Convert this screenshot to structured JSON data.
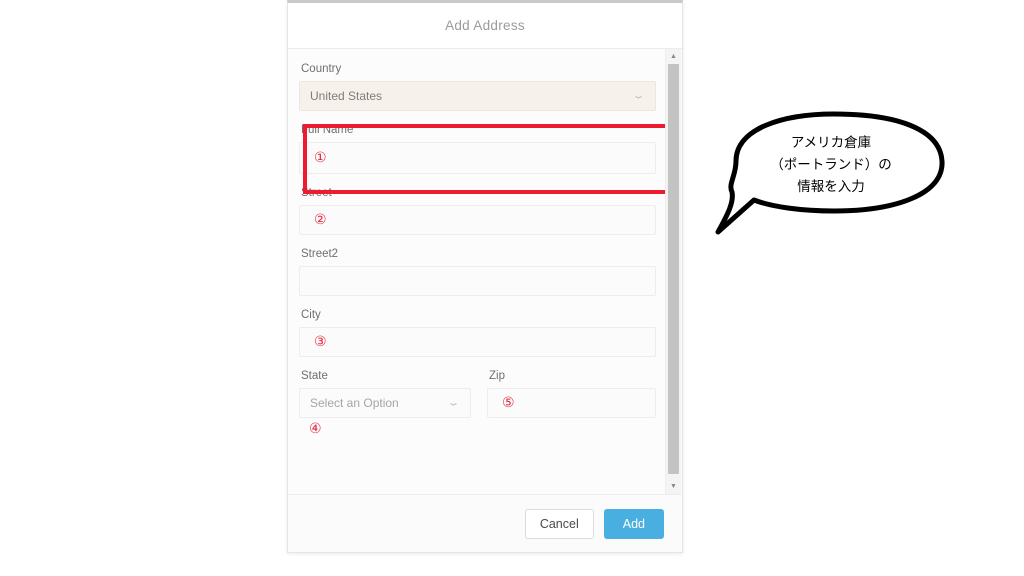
{
  "modal": {
    "title": "Add Address",
    "fields": {
      "country": {
        "label": "Country",
        "value": "United States",
        "chevron": "⌄"
      },
      "full_name": {
        "label": "Full Name",
        "value": "",
        "marker": "①"
      },
      "street": {
        "label": "Street",
        "value": "",
        "marker": "②"
      },
      "street2": {
        "label": "Street2",
        "value": ""
      },
      "city": {
        "label": "City",
        "value": "",
        "marker": "③"
      },
      "state": {
        "label": "State",
        "placeholder": "Select an Option",
        "chevron": "⌄",
        "marker": "④"
      },
      "zip": {
        "label": "Zip",
        "value": "",
        "marker": "⑤"
      }
    },
    "footer": {
      "cancel_label": "Cancel",
      "add_label": "Add"
    },
    "scrollbar": {
      "up_arrow": "▲",
      "down_arrow": "▼"
    }
  },
  "callout": {
    "text": "アメリカ倉庫\n（ポートランド）の\n情報を入力"
  },
  "colors": {
    "highlight_red": "#ed1b2f",
    "marker_red": "#e8243c",
    "primary_button": "#49aee0",
    "autofill_field": "#f6f1ea",
    "label_gray": "#6f6f6f",
    "title_gray": "#9b9b9b"
  }
}
